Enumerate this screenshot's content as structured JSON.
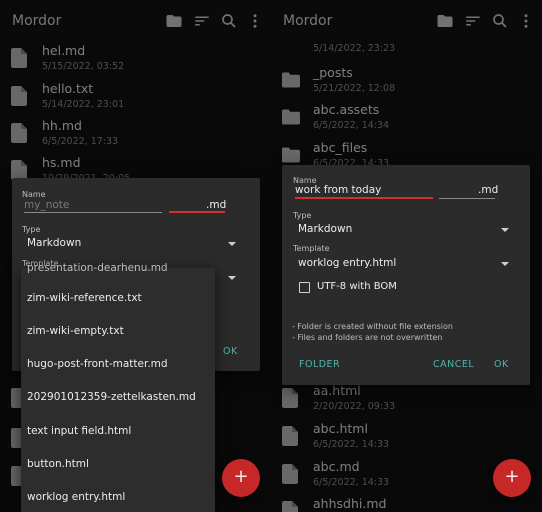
{
  "left": {
    "app_title": "Mordor",
    "files": [
      {
        "name": "hel.md",
        "date": "5/15/2022, 03:52"
      },
      {
        "name": "hello.txt",
        "date": "5/14/2022, 23:01"
      },
      {
        "name": "hh.md",
        "date": "6/5/2022, 17:33"
      },
      {
        "name": "hs.md",
        "date": "10/29/2021, 20:05"
      }
    ],
    "dialog": {
      "name_label": "Name",
      "name_placeholder": "my_note",
      "ext_value": ".md",
      "type_label": "Type",
      "type_value": "Markdown",
      "template_label": "Template",
      "ok_label": "OK"
    },
    "template_menu": {
      "partial_item": "presentation-dearhenu.md",
      "items": [
        "zim-wiki-reference.txt",
        "zim-wiki-empty.txt",
        "hugo-post-front-matter.md",
        "202901012359-zettelkasten.md",
        "text input field.html",
        "button.html",
        "worklog entry.html"
      ]
    },
    "fab_label": "+"
  },
  "right": {
    "app_title": "Mordor",
    "files_top": [
      {
        "name": "",
        "date": "5/14/2022, 23:23",
        "type": "file"
      },
      {
        "name": "_posts",
        "date": "5/21/2022, 12:08",
        "type": "folder"
      },
      {
        "name": "abc.assets",
        "date": "6/5/2022, 14:34",
        "type": "folder"
      },
      {
        "name": "abc_files",
        "date": "6/5/2022, 14:33",
        "type": "folder"
      }
    ],
    "files_bottom": [
      {
        "name": "aa.html",
        "date": "2/20/2022, 09:33"
      },
      {
        "name": "abc.html",
        "date": "6/5/2022, 14:33"
      },
      {
        "name": "abc.md",
        "date": "6/5/2022, 14:33"
      },
      {
        "name": "ahhsdhi.md",
        "date": ""
      }
    ],
    "dialog": {
      "name_label": "Name",
      "name_value": "work from today",
      "ext_value": ".md",
      "type_label": "Type",
      "type_value": "Markdown",
      "template_label": "Template",
      "template_value": "worklog entry.html",
      "bom_label": "UTF-8 with BOM",
      "bom_checked": false,
      "note1": "- Folder is created without file extension",
      "note2": "- Files and folders are not overwritten",
      "folder_label": "FOLDER",
      "cancel_label": "CANCEL",
      "ok_label": "OK"
    },
    "fab_label": "+"
  },
  "icons": {
    "folder": "folder-icon",
    "sort": "sort-icon",
    "search": "search-icon",
    "more": "more-vert-icon"
  },
  "colors": {
    "accent": "#4db6ac",
    "error_underline": "#d32f2f",
    "fab": "#c62828"
  }
}
